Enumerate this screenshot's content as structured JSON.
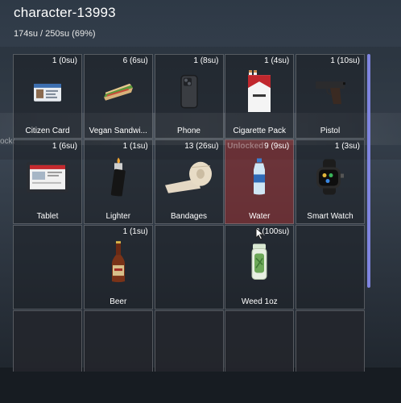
{
  "header": {
    "title": "character-13993",
    "capacity": "174su / 250su (69%)"
  },
  "background_text": {
    "left": "ocked",
    "slot": "Unlocked"
  },
  "slots": [
    {
      "qty": "1 (0su)",
      "label": "Citizen Card",
      "icon": "id-card-icon"
    },
    {
      "qty": "6 (6su)",
      "label": "Vegan Sandwi...",
      "icon": "sandwich-icon"
    },
    {
      "qty": "1 (8su)",
      "label": "Phone",
      "icon": "phone-icon"
    },
    {
      "qty": "1 (4su)",
      "label": "Cigarette Pack",
      "icon": "cigarette-pack-icon"
    },
    {
      "qty": "1 (10su)",
      "label": "Pistol",
      "icon": "pistol-icon"
    },
    {
      "qty": "1 (6su)",
      "label": "Tablet",
      "icon": "tablet-icon"
    },
    {
      "qty": "1 (1su)",
      "label": "Lighter",
      "icon": "lighter-icon"
    },
    {
      "qty": "13 (26su)",
      "label": "Bandages",
      "icon": "bandage-icon"
    },
    {
      "qty": "9 (9su)",
      "label": "Water",
      "icon": "water-bottle-icon"
    },
    {
      "qty": "1 (3su)",
      "label": "Smart Watch",
      "icon": "smart-watch-icon"
    },
    {
      "qty": "",
      "label": "",
      "icon": ""
    },
    {
      "qty": "1 (1su)",
      "label": "Beer",
      "icon": "beer-bottle-icon"
    },
    {
      "qty": "",
      "label": "",
      "icon": ""
    },
    {
      "qty": "2 (100su)",
      "label": "Weed 1oz",
      "icon": "weed-jar-icon"
    },
    {
      "qty": "",
      "label": "",
      "icon": ""
    },
    {
      "qty": "",
      "label": "",
      "icon": ""
    },
    {
      "qty": "",
      "label": "",
      "icon": ""
    },
    {
      "qty": "",
      "label": "",
      "icon": ""
    },
    {
      "qty": "",
      "label": "",
      "icon": ""
    },
    {
      "qty": "",
      "label": "",
      "icon": ""
    }
  ],
  "colors": {
    "scrollbar": "#7f85e0",
    "slot_border": "#969ba0"
  }
}
